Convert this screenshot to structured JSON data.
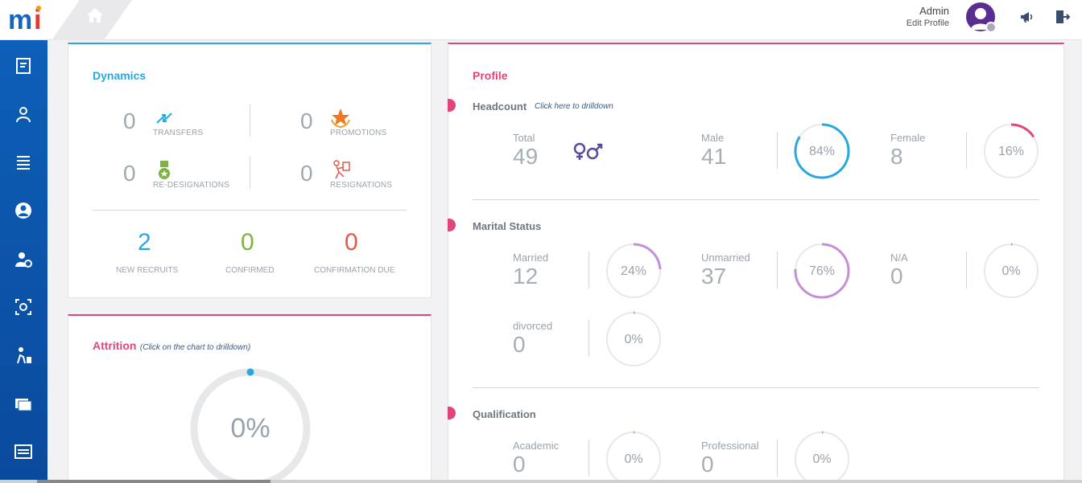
{
  "header": {
    "user_name": "Admin",
    "edit_profile": "Edit Profile"
  },
  "dynamics": {
    "title": "Dynamics",
    "transfers": {
      "value": "0",
      "label": "TRANSFERS"
    },
    "promotions": {
      "value": "0",
      "label": "PROMOTIONS"
    },
    "redesignations": {
      "value": "0",
      "label": "RE-DESIGNATIONS"
    },
    "resignations": {
      "value": "0",
      "label": "RESIGNATIONS"
    },
    "new_recruits": {
      "value": "2",
      "label": "NEW RECRUITS"
    },
    "confirmed": {
      "value": "0",
      "label": "CONFIRMED"
    },
    "confirmation_due": {
      "value": "0",
      "label": "CONFIRMATION DUE"
    }
  },
  "attrition": {
    "title": "Attrition",
    "hint": "(Click on the chart to drilldown)",
    "percent_label": "0%",
    "percent": 0
  },
  "profile": {
    "title": "Profile",
    "headcount": {
      "title": "Headcount",
      "hint": "Click here to drilldown",
      "total_label": "Total",
      "total_value": "49",
      "male_label": "Male",
      "male_value": "41",
      "male_pct_label": "84%",
      "male_pct": 84,
      "female_label": "Female",
      "female_value": "8",
      "female_pct_label": "16%",
      "female_pct": 16
    },
    "marital": {
      "title": "Marital Status",
      "married_label": "Married",
      "married_value": "12",
      "married_pct_label": "24%",
      "married_pct": 24,
      "unmarried_label": "Unmarried",
      "unmarried_value": "37",
      "unmarried_pct_label": "76%",
      "unmarried_pct": 76,
      "na_label": "N/A",
      "na_value": "0",
      "na_pct_label": "0%",
      "na_pct": 0,
      "divorced_label": "divorced",
      "divorced_value": "0",
      "divorced_pct_label": "0%",
      "divorced_pct": 0
    },
    "qualification": {
      "title": "Qualification",
      "academic_label": "Academic",
      "academic_value": "0",
      "academic_pct_label": "0%",
      "academic_pct": 0,
      "professional_label": "Professional",
      "professional_value": "0",
      "professional_pct_label": "0%",
      "professional_pct": 0
    }
  },
  "colors": {
    "accent_blue": "#29a8e0",
    "accent_pink": "#e0467c",
    "green": "#7cb342",
    "red": "#e05a4e",
    "purple": "#c58fd8",
    "orange": "#f0a030",
    "sidebar": "#0d5fb8"
  }
}
